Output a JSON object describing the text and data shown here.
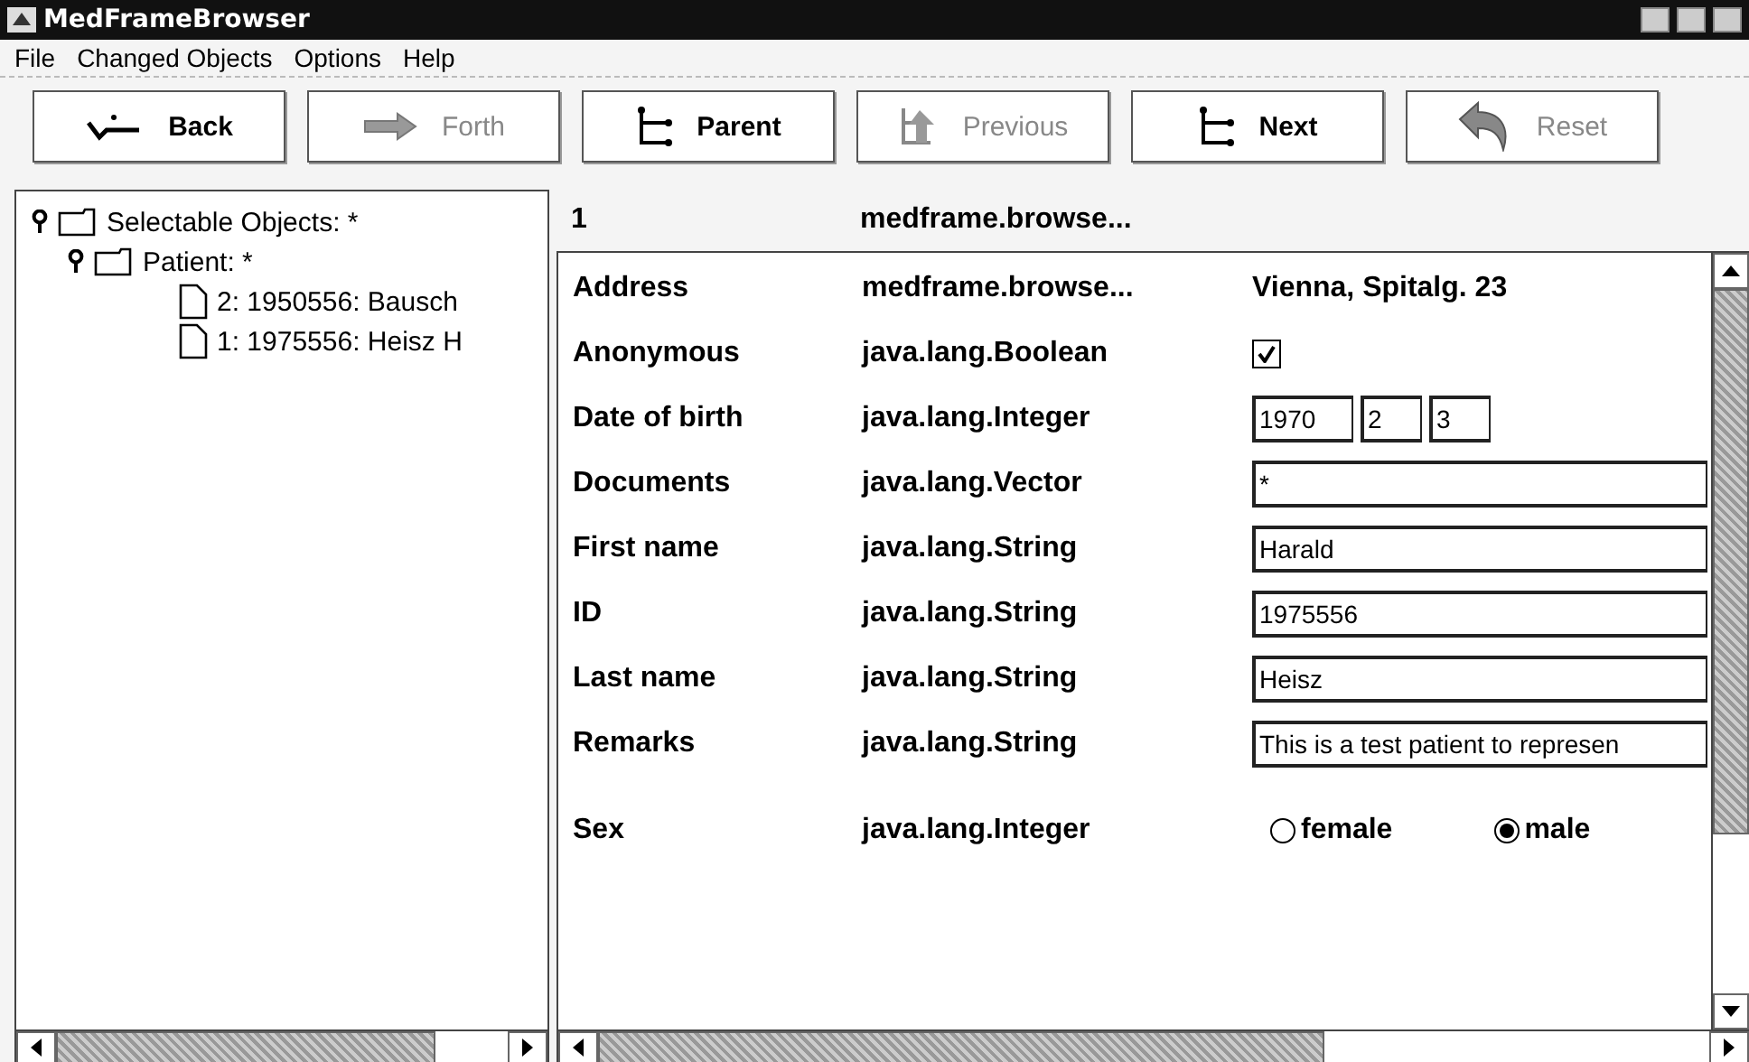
{
  "window": {
    "title": "MedFrameBrowser"
  },
  "menu": [
    "File",
    "Changed Objects",
    "Options",
    "Help"
  ],
  "toolbar": [
    {
      "label": "Back",
      "disabled": false
    },
    {
      "label": "Forth",
      "disabled": true
    },
    {
      "label": "Parent",
      "disabled": false
    },
    {
      "label": "Previous",
      "disabled": true
    },
    {
      "label": "Next",
      "disabled": false
    },
    {
      "label": "Reset",
      "disabled": true
    }
  ],
  "tree": [
    {
      "label": "Selectable Objects: *",
      "expanded": true,
      "children": [
        {
          "label": "Patient: *",
          "expanded": true,
          "children": [
            {
              "label": "2: 1950556: Bausch"
            },
            {
              "label": "1: 1975556: Heisz H"
            }
          ]
        }
      ]
    }
  ],
  "object_header": {
    "column_1": "1",
    "column_2": "medframe.browse..."
  },
  "properties": [
    {
      "name": "Address",
      "type": "medframe.browse...",
      "kind": "text",
      "value": "Vienna, Spitalg. 23"
    },
    {
      "name": "Anonymous",
      "type": "java.lang.Boolean",
      "kind": "checkbox",
      "checked": true
    },
    {
      "name": "Date of birth",
      "type": "java.lang.Integer",
      "kind": "date",
      "values": [
        "1970",
        "2",
        "3"
      ]
    },
    {
      "name": "Documents",
      "type": "java.lang.Vector",
      "kind": "field",
      "value": "*"
    },
    {
      "name": "First name",
      "type": "java.lang.String",
      "kind": "field",
      "value": "Harald"
    },
    {
      "name": "ID",
      "type": "java.lang.String",
      "kind": "field",
      "value": "1975556"
    },
    {
      "name": "Last name",
      "type": "java.lang.String",
      "kind": "field",
      "value": "Heisz"
    },
    {
      "name": "Remarks",
      "type": "java.lang.String",
      "kind": "field",
      "value": "This is a test patient to represen"
    },
    {
      "name": "Sex",
      "type": "java.lang.Integer",
      "kind": "radio",
      "options": [
        {
          "label": "female",
          "selected": false
        },
        {
          "label": "male",
          "selected": true
        }
      ]
    }
  ]
}
